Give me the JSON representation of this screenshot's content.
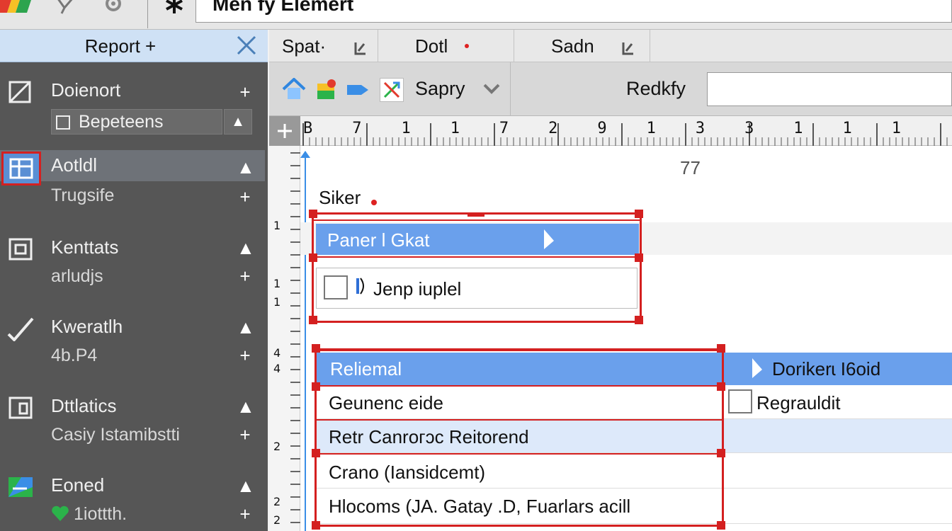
{
  "window": {
    "title": "Men fy Elemert"
  },
  "sidebar": {
    "header": "Report +",
    "sub_item": "Bepeteens",
    "items": [
      {
        "label": "Doienort",
        "sub": ""
      },
      {
        "label": "Aotldl",
        "sub": "Trugsife"
      },
      {
        "label": "Kenttats",
        "sub": "arludjs"
      },
      {
        "label": "Kweratlh",
        "sub": "4b.P4"
      },
      {
        "label": "Dttlatics",
        "sub": "Casiy Istamibstti"
      },
      {
        "label": "Eoned",
        "sub": "1iottth."
      }
    ]
  },
  "tabs": [
    {
      "label": "Spat·"
    },
    {
      "label": "Dotl"
    },
    {
      "label": "Sadn"
    }
  ],
  "toolbar": {
    "dropdown_label": "Sapry",
    "right_label": "Redkfy",
    "input_value": ""
  },
  "ruler": {
    "ticks": [
      "B",
      "7",
      "1",
      "1",
      "7",
      "2",
      "9",
      "1",
      "3",
      "3",
      "1",
      "1",
      "1"
    ]
  },
  "vruler": {
    "ticks": [
      "1",
      "1",
      "1",
      "4",
      "4",
      "2",
      "2",
      "2"
    ]
  },
  "canvas": {
    "number": "77",
    "section_label": "Siker",
    "group1": {
      "header": "Paner l Gkat",
      "row": "Jenp iuplel"
    },
    "group2": {
      "header": "Reliemal",
      "header_right": "Dorikerɩ I6oid",
      "rows": [
        {
          "left": "Geunenc eide",
          "right": "Regrauldit"
        },
        {
          "left": "Retr Canroᴦɔc Reitorend",
          "right": ""
        },
        {
          "left": "Crano (Iansidcemt)",
          "right": ""
        },
        {
          "left": "Hlocoms (JA. Gatay .D, Fuarlars acill",
          "right": ""
        }
      ]
    }
  },
  "colors": {
    "accent_blue": "#6aa0ec",
    "selection_red": "#d42020",
    "sidebar_bg": "#565656"
  }
}
